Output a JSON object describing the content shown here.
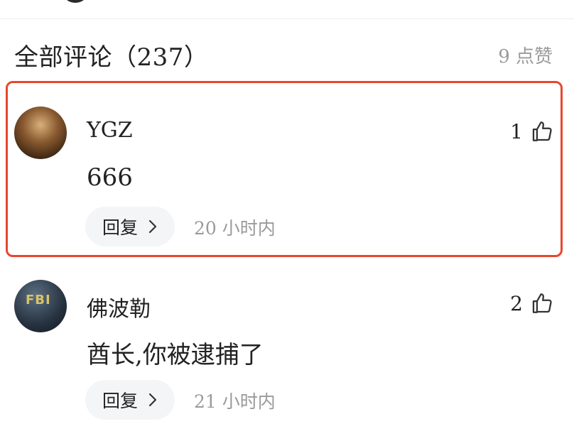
{
  "header": {
    "title": "全部评论（237）",
    "like_summary": "9 点赞"
  },
  "comments": [
    {
      "username": "YGZ",
      "text": "666",
      "like_count": "1",
      "reply_label": "回复",
      "timestamp": "20 小时内",
      "highlighted": true
    },
    {
      "username": "佛波勒",
      "text": "酋长,你被逮捕了",
      "like_count": "2",
      "reply_label": "回复",
      "timestamp": "21 小时内",
      "highlighted": false
    }
  ],
  "icons": {
    "like": "thumbs-up-icon",
    "reply_chevron": "chevron-right-icon"
  },
  "colors": {
    "highlight_border": "#e8472e",
    "muted_text": "#9a9a9a",
    "reply_pill_bg": "#f4f5f7"
  }
}
